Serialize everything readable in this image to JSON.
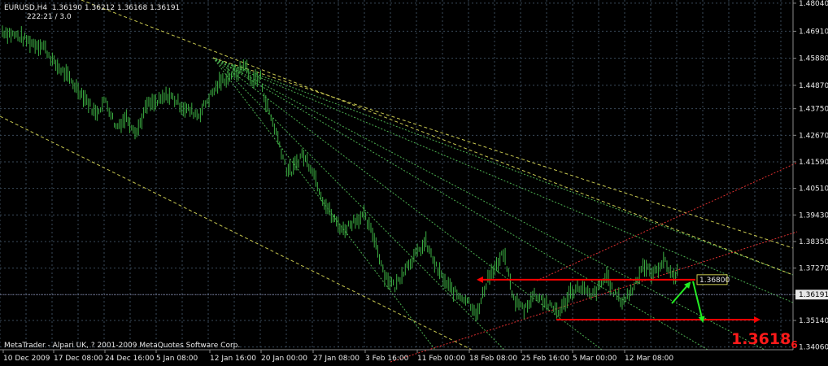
{
  "header": {
    "symbol_line": "EURUSD,H4  1.36190 1.36212 1.36168 1.36191",
    "sub_line": "222:21 / 3.0"
  },
  "footer": {
    "copyright": "MetaTrader - Alpari UK, ? 2001-2009 MetaQuotes Software Corp."
  },
  "big_price": {
    "main": "1.3618",
    "sub": "6"
  },
  "colors": {
    "background": "#000000",
    "grid": "#3a4a5a",
    "candles": "#3cb043",
    "pitchfork": "#c8c850",
    "fan": "#4caf50",
    "channel": "#e03030",
    "arrow_red": "#ff0000",
    "arrow_green": "#22ee22",
    "text": "#e8e8e8"
  },
  "chart_data": {
    "type": "line",
    "x_ticks": [
      "10 Dec 2009",
      "17 Dec 08:00",
      "24 Dec 16:00",
      "5 Jan 08:00",
      "12 Jan 16:00",
      "20 Jan 00:00",
      "27 Jan 08:00",
      "3 Feb 16:00",
      "11 Feb 00:00",
      "18 Feb 08:00",
      "25 Feb 16:00",
      "5 Mar 00:00",
      "12 Mar 08:00"
    ],
    "y_ticks": [
      1.4804,
      1.469,
      1.458,
      1.447,
      1.4375,
      1.4267,
      1.4159,
      1.4051,
      1.3943,
      1.3835,
      1.3727,
      1.3619,
      1.3514,
      1.3406
    ],
    "y_tick_labels": [
      "1.48040",
      "1.46910",
      "1.45880",
      "1.44870",
      "1.43750",
      "1.42670",
      "1.41590",
      "1.40510",
      "1.39430",
      "1.38350",
      "1.37270",
      "1.36191",
      "1.35140",
      "1.34060"
    ],
    "ylim": [
      1.3395,
      1.4817
    ],
    "current_price": 1.36191,
    "price_label": "1.36800",
    "price_label_value": 1.368,
    "price_path": [
      [
        0,
        1.469
      ],
      [
        3,
        1.467
      ],
      [
        6,
        1.464
      ],
      [
        8,
        1.463
      ],
      [
        10,
        1.456
      ],
      [
        12,
        1.452
      ],
      [
        14,
        1.447
      ],
      [
        16,
        1.442
      ],
      [
        18,
        1.4355
      ],
      [
        20,
        1.441
      ],
      [
        22,
        1.43
      ],
      [
        24,
        1.434
      ],
      [
        26,
        1.428
      ],
      [
        28,
        1.439
      ],
      [
        30,
        1.44
      ],
      [
        32,
        1.443
      ],
      [
        33,
        1.442
      ],
      [
        35,
        1.438
      ],
      [
        37,
        1.436
      ],
      [
        38,
        1.435
      ],
      [
        40,
        1.442
      ],
      [
        42,
        1.448
      ],
      [
        44,
        1.451
      ],
      [
        46,
        1.453
      ],
      [
        47,
        1.456
      ],
      [
        48,
        1.449
      ],
      [
        50,
        1.45
      ],
      [
        51,
        1.44
      ],
      [
        53,
        1.428
      ],
      [
        55,
        1.413
      ],
      [
        56,
        1.412
      ],
      [
        58,
        1.419
      ],
      [
        60,
        1.413
      ],
      [
        62,
        1.401
      ],
      [
        64,
        1.393
      ],
      [
        66,
        1.388
      ],
      [
        68,
        1.392
      ],
      [
        70,
        1.394
      ],
      [
        72,
        1.385
      ],
      [
        74,
        1.37
      ],
      [
        76,
        1.365
      ],
      [
        78,
        1.373
      ],
      [
        80,
        1.378
      ],
      [
        82,
        1.383
      ],
      [
        84,
        1.373
      ],
      [
        86,
        1.366
      ],
      [
        88,
        1.362
      ],
      [
        90,
        1.36
      ],
      [
        92,
        1.354
      ],
      [
        94,
        1.369
      ],
      [
        96,
        1.374
      ],
      [
        97,
        1.379
      ],
      [
        98,
        1.37
      ],
      [
        99,
        1.36
      ],
      [
        101,
        1.356
      ],
      [
        103,
        1.362
      ],
      [
        104,
        1.361
      ],
      [
        106,
        1.357
      ],
      [
        108,
        1.355
      ],
      [
        110,
        1.363
      ],
      [
        112,
        1.365
      ],
      [
        114,
        1.361
      ],
      [
        116,
        1.366
      ],
      [
        117,
        1.37
      ],
      [
        118,
        1.364
      ],
      [
        120,
        1.359
      ],
      [
        122,
        1.364
      ],
      [
        124,
        1.374
      ],
      [
        126,
        1.37
      ],
      [
        128,
        1.376
      ],
      [
        130,
        1.369
      ],
      [
        131,
        1.3719
      ]
    ]
  }
}
